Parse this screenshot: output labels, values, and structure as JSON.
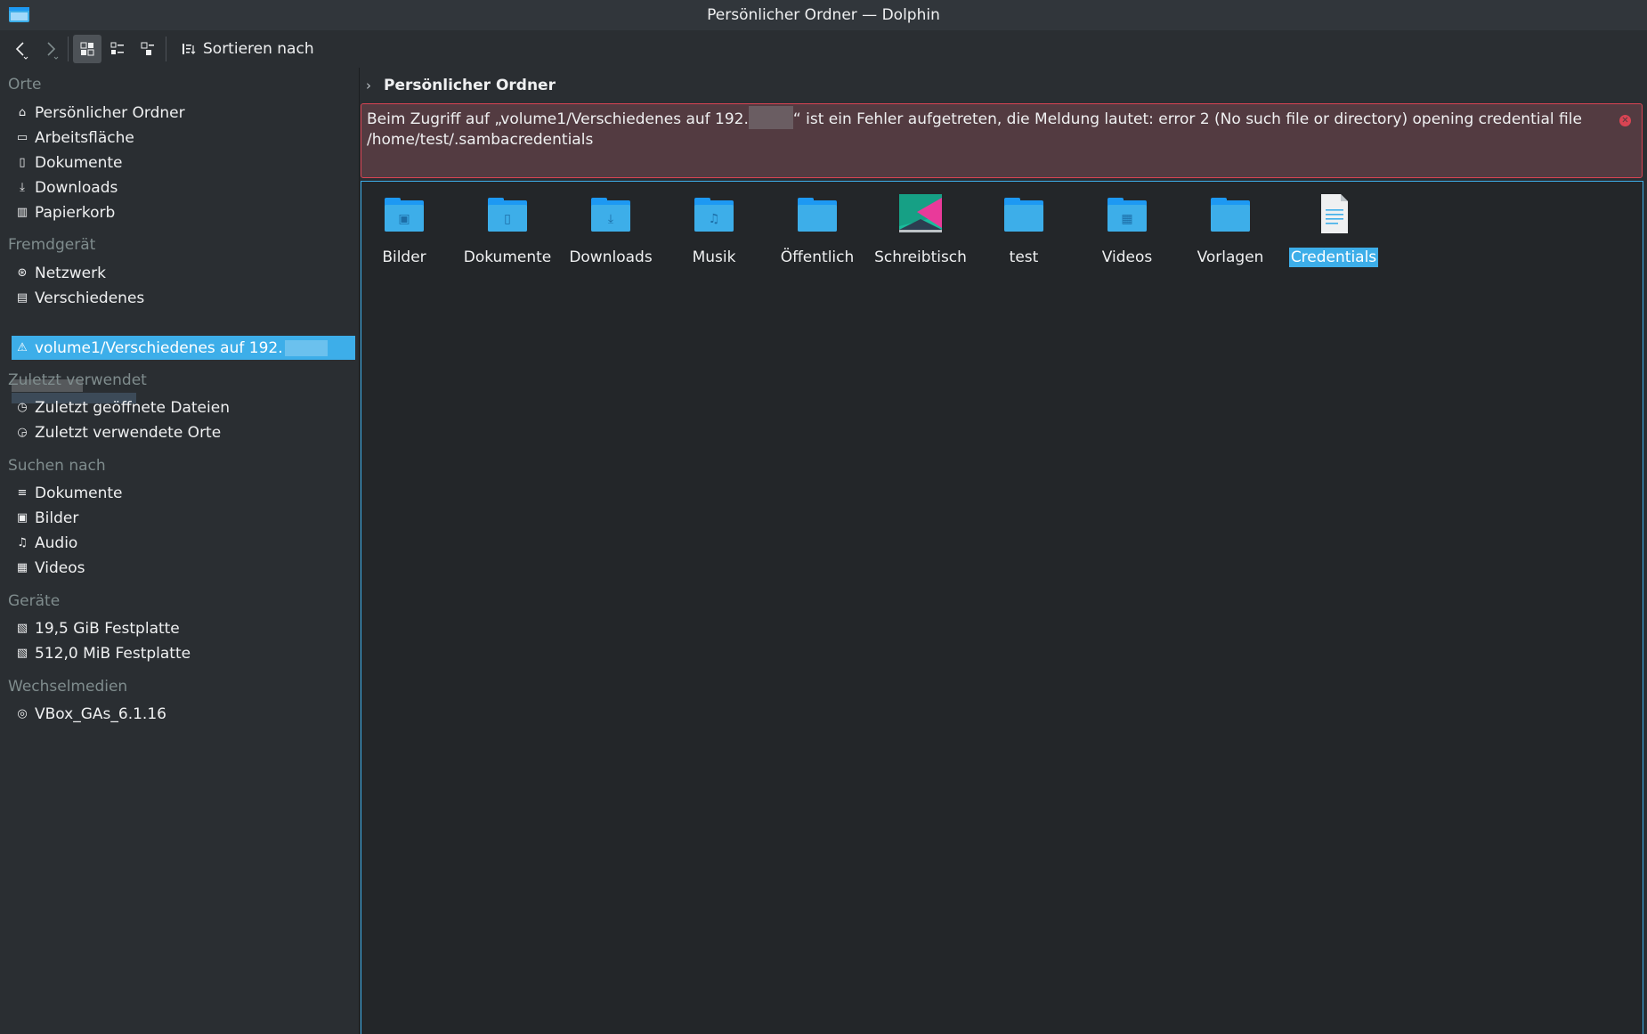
{
  "window": {
    "title": "Persönlicher Ordner — Dolphin"
  },
  "toolbar": {
    "sort_label": "Sortieren nach"
  },
  "sidebar": {
    "sections": [
      {
        "heading": "Orte",
        "items": [
          {
            "label": "Persönlicher Ordner",
            "icon": "home-icon"
          },
          {
            "label": "Arbeitsfläche",
            "icon": "desktop-icon"
          },
          {
            "label": "Dokumente",
            "icon": "document-icon"
          },
          {
            "label": "Downloads",
            "icon": "download-icon"
          },
          {
            "label": "Papierkorb",
            "icon": "trash-icon"
          }
        ]
      },
      {
        "heading": "Fremdgerät",
        "items": [
          {
            "label": "Netzwerk",
            "icon": "network-icon"
          },
          {
            "label": "Verschiedenes",
            "icon": "server-icon"
          },
          {
            "label": "volume1/Verschiedenes auf 192.",
            "icon": "network-share-error-icon",
            "selected": true
          }
        ]
      },
      {
        "heading": "Zuletzt verwendet",
        "items": [
          {
            "label": "Zuletzt geöffnete Dateien",
            "icon": "recent-files-icon"
          },
          {
            "label": "Zuletzt verwendete Orte",
            "icon": "recent-places-icon"
          }
        ]
      },
      {
        "heading": "Suchen nach",
        "items": [
          {
            "label": "Dokumente",
            "icon": "text-document-icon"
          },
          {
            "label": "Bilder",
            "icon": "image-icon"
          },
          {
            "label": "Audio",
            "icon": "music-note-icon"
          },
          {
            "label": "Videos",
            "icon": "video-icon"
          }
        ]
      },
      {
        "heading": "Geräte",
        "items": [
          {
            "label": "19,5 GiB Festplatte",
            "icon": "harddisk-icon"
          },
          {
            "label": "512,0 MiB Festplatte",
            "icon": "harddisk-icon"
          }
        ]
      },
      {
        "heading": "Wechselmedien",
        "items": [
          {
            "label": "VBox_GAs_6.1.16",
            "icon": "optical-disc-icon"
          }
        ]
      }
    ]
  },
  "breadcrumb": {
    "label": "Persönlicher Ordner"
  },
  "error": {
    "text_before": "Beim Zugriff auf „volume1/Verschiedenes auf 192.",
    "text_after": "“ ist ein Fehler aufgetreten, die Meldung lautet: error 2 (No such file or directory) opening credential file /home/test/.sambacredentials"
  },
  "files": [
    {
      "name": "Bilder",
      "icon": "folder-pictures-icon"
    },
    {
      "name": "Dokumente",
      "icon": "folder-documents-icon"
    },
    {
      "name": "Downloads",
      "icon": "folder-download-icon"
    },
    {
      "name": "Musik",
      "icon": "folder-music-icon"
    },
    {
      "name": "Öffentlich",
      "icon": "folder-icon"
    },
    {
      "name": "Schreibtisch",
      "icon": "desktop-folder-icon"
    },
    {
      "name": "test",
      "icon": "folder-icon"
    },
    {
      "name": "Videos",
      "icon": "folder-videos-icon"
    },
    {
      "name": "Vorlagen",
      "icon": "folder-icon"
    },
    {
      "name": "Credentials",
      "icon": "text-file-icon",
      "selected": true
    }
  ]
}
